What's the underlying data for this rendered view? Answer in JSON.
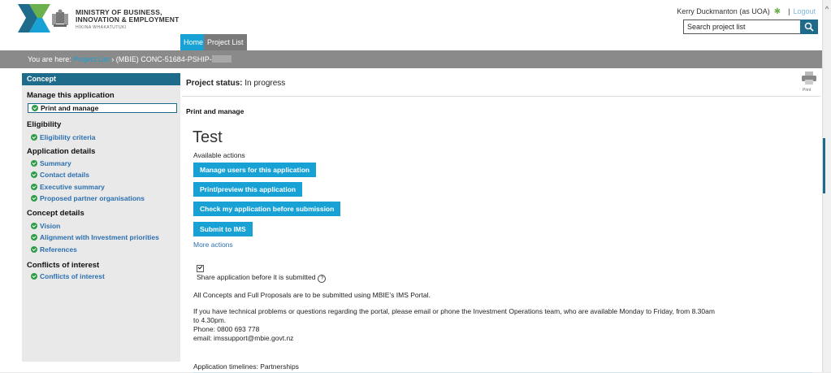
{
  "header": {
    "ministry_line1": "MINISTRY OF BUSINESS,",
    "ministry_line2": "INNOVATION & EMPLOYMENT",
    "ministry_line3": "HĪKINA WHAKATUTUKI",
    "user": "Kerry Duckmanton (as UOA)",
    "separator": "|",
    "logout": "Logout",
    "search_placeholder": "Search project list"
  },
  "tabs": [
    {
      "label": "Home"
    },
    {
      "label": "Project List"
    }
  ],
  "breadcrumb": {
    "prefix": "You are here:",
    "link": "Project List",
    "current": "› (MBIE) CONC-51684-PSHIP-"
  },
  "sidebar": {
    "title": "Concept",
    "sections": [
      {
        "heading": "Manage this application",
        "items": [
          "Print and manage"
        ]
      },
      {
        "heading": "Eligibility",
        "items": [
          "Eligibility criteria"
        ]
      },
      {
        "heading": "Application details",
        "items": [
          "Summary",
          "Contact details",
          "Executive summary",
          "Proposed partner organisations"
        ]
      },
      {
        "heading": "Concept details",
        "items": [
          "Vision",
          "Alignment with Investment priorities",
          "References"
        ]
      },
      {
        "heading": "Conflicts of interest",
        "items": [
          "Conflicts of interest"
        ]
      }
    ]
  },
  "main": {
    "status_label": "Project status:",
    "status_value": "In progress",
    "print_label": "Print",
    "section_title": "Print and manage",
    "project_title": "Test",
    "available_actions": "Available actions",
    "actions": [
      "Manage users for this application",
      "Print/preview this application",
      "Check my application before submission",
      "Submit to IMS"
    ],
    "more_actions": "More actions",
    "share_label": "Share application before it is submitted",
    "info1": "All Concepts and Full Proposals are to be submitted using MBIE’s IMS Portal.",
    "info2a": "If you have technical problems or questions regarding the portal, please email or phone the Investment Operations team, who are available Monday to Friday, from 8.30am",
    "info2b": "to 4.30pm.",
    "phone": "Phone: 0800 693 778",
    "email": "email: imssupport@mbie.govt.nz",
    "timelines": "Application timelines: Partnerships"
  },
  "colors": {
    "accent": "#17a1d4",
    "dark_teal": "#1e6b8c",
    "check_green": "#2c9c47"
  }
}
